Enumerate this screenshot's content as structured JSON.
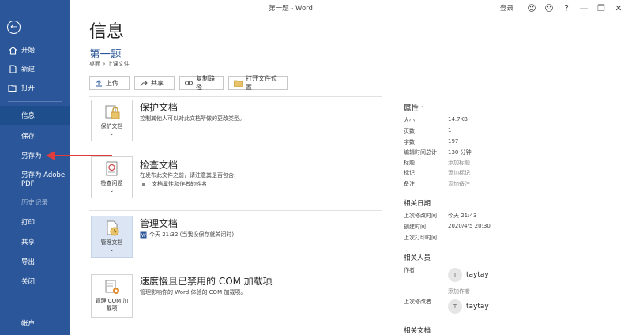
{
  "window": {
    "title": "第一题  -  Word",
    "signin": "登录",
    "help": "?"
  },
  "sidebar": {
    "back_icon": "back-arrow-icon",
    "items": [
      {
        "label": "开始",
        "icon": "home-icon"
      },
      {
        "label": "新建",
        "icon": "new-doc-icon"
      },
      {
        "label": "打开",
        "icon": "folder-open-icon"
      },
      {
        "label": "信息"
      },
      {
        "label": "保存"
      },
      {
        "label": "另存为"
      },
      {
        "label": "另存为 Adobe PDF"
      },
      {
        "label": "历史记录"
      },
      {
        "label": "打印"
      },
      {
        "label": "共享"
      },
      {
        "label": "导出"
      },
      {
        "label": "关闭"
      },
      {
        "label": "帐户"
      }
    ]
  },
  "main": {
    "page_title": "信息",
    "doc_title": "第一题",
    "doc_path": "桌面 » 上课文件",
    "actions": [
      {
        "label": "上传",
        "icon": "upload-icon"
      },
      {
        "label": "共享",
        "icon": "share-icon"
      },
      {
        "label": "复制路径",
        "icon": "link-icon"
      },
      {
        "label": "打开文件位置",
        "icon": "folder-icon"
      }
    ],
    "sections": [
      {
        "tile": "保护文档",
        "title": "保护文档",
        "desc": "控制其他人可以对此文档所做的更改类型。",
        "icon": "lock-key-icon"
      },
      {
        "tile": "检查问题",
        "title": "检查文档",
        "desc": "在发布此文件之前，请注意其是否包含:",
        "bullet": "文档属性和作者的姓名",
        "icon": "inspect-doc-icon"
      },
      {
        "tile": "管理文档",
        "title": "管理文档",
        "desc": "今天 21:32 (当我没保存就关闭时)",
        "icon": "manage-doc-icon"
      },
      {
        "tile": "管理 COM 加载项",
        "title": "速度慢且已禁用的 COM 加载项",
        "desc": "管理影响你的 Word 体验的 COM 加载项。",
        "icon": "com-addin-icon"
      }
    ]
  },
  "properties": {
    "header": "属性",
    "rows": [
      {
        "k": "大小",
        "v": "14.7KB"
      },
      {
        "k": "页数",
        "v": "1"
      },
      {
        "k": "字数",
        "v": "197"
      },
      {
        "k": "编辑时间总计",
        "v": "130 分钟"
      },
      {
        "k": "标题",
        "v": "添加标题"
      },
      {
        "k": "标记",
        "v": "添加标记"
      },
      {
        "k": "备注",
        "v": "添加备注"
      }
    ],
    "dates_header": "相关日期",
    "dates": [
      {
        "k": "上次修改时间",
        "v": "今天 21:43"
      },
      {
        "k": "创建时间",
        "v": "2020/4/5 20:30"
      },
      {
        "k": "上次打印时间",
        "v": ""
      }
    ],
    "people_header": "相关人员",
    "author_label": "作者",
    "author": "taytay",
    "add_author": "添加作者",
    "last_modified_by_label": "上次修改者",
    "last_modified_by": "taytay",
    "docs_header": "相关文档"
  }
}
